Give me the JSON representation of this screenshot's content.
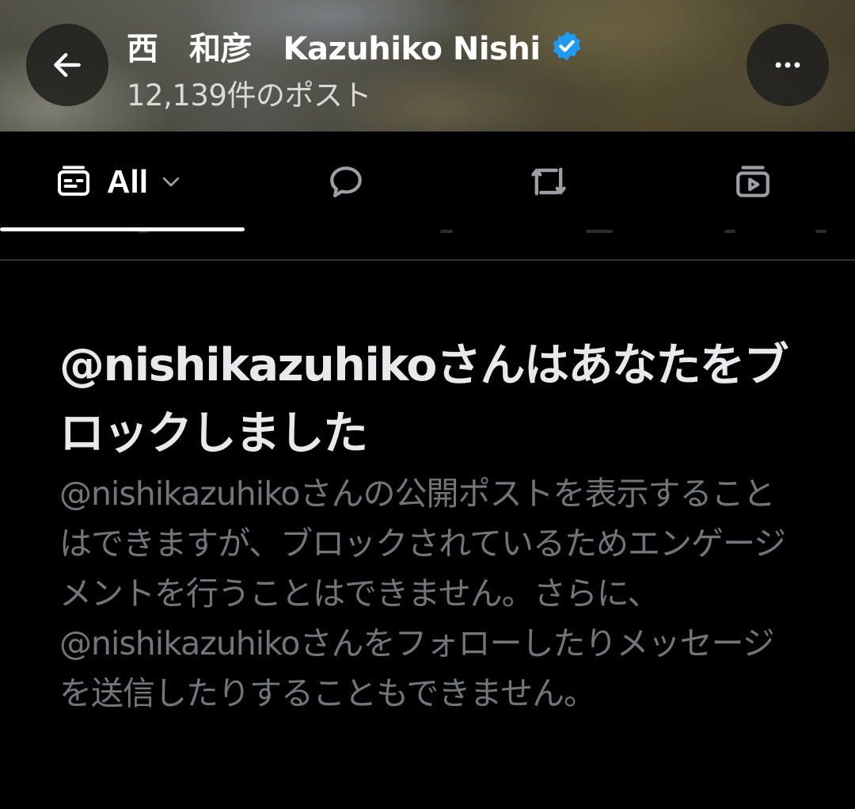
{
  "header": {
    "display_name": "西　和彦　Kazuhiko Nishi",
    "verified": true,
    "verified_color": "#1d9bf0",
    "post_count": "12,139件のポスト",
    "back_icon": "arrow-left-icon",
    "more_icon": "more-horizontal-icon"
  },
  "tabs": [
    {
      "label": "All",
      "icon": "feed-card-icon",
      "selected": true,
      "has_dropdown": true
    },
    {
      "label": "",
      "icon": "speech-bubble-icon",
      "selected": false
    },
    {
      "label": "",
      "icon": "repost-icon",
      "selected": false
    },
    {
      "label": "",
      "icon": "video-play-icon",
      "selected": false
    }
  ],
  "blocked_notice": {
    "title": "@nishikazuhikoさんはあなたをブロックしました",
    "body": "@nishikazuhikoさんの公開ポストを表示することはできますが、ブロックされているためエンゲージメントを行うことはできません。さらに、@nishikazuhikoさんをフォローしたりメッセージを送信したりすることもできません。"
  },
  "colors": {
    "background": "#000000",
    "primary_text": "#e7e9ea",
    "secondary_text": "#71767b",
    "divider": "#2f3336",
    "accent": "#1d9bf0"
  }
}
